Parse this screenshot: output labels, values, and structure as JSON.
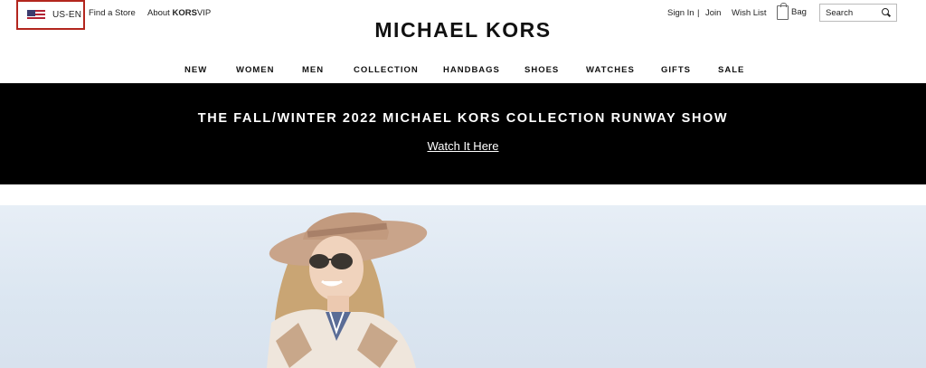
{
  "header": {
    "locale": "US-EN",
    "find_store": "Find a Store",
    "about_prefix": "About ",
    "about_brand": "KORS",
    "about_suffix": "VIP",
    "logo": "MICHAEL KORS",
    "sign_in": "Sign In",
    "separator": "|",
    "join": "Join",
    "wish_list": "Wish List",
    "bag": "Bag",
    "search_placeholder": "Search"
  },
  "nav": {
    "items": [
      "NEW",
      "WOMEN",
      "MEN",
      "COLLECTION",
      "HANDBAGS",
      "SHOES",
      "WATCHES",
      "GIFTS",
      "SALE"
    ]
  },
  "banner": {
    "title": "THE FALL/WINTER 2022 MICHAEL KORS COLLECTION RUNWAY SHOW",
    "link": "Watch It Here"
  },
  "colors": {
    "accent_border": "#b3261e",
    "banner_bg": "#000000",
    "hero_sky": "#dbe6f1"
  },
  "icons": [
    "us-flag-icon",
    "bag-icon",
    "search-icon"
  ]
}
